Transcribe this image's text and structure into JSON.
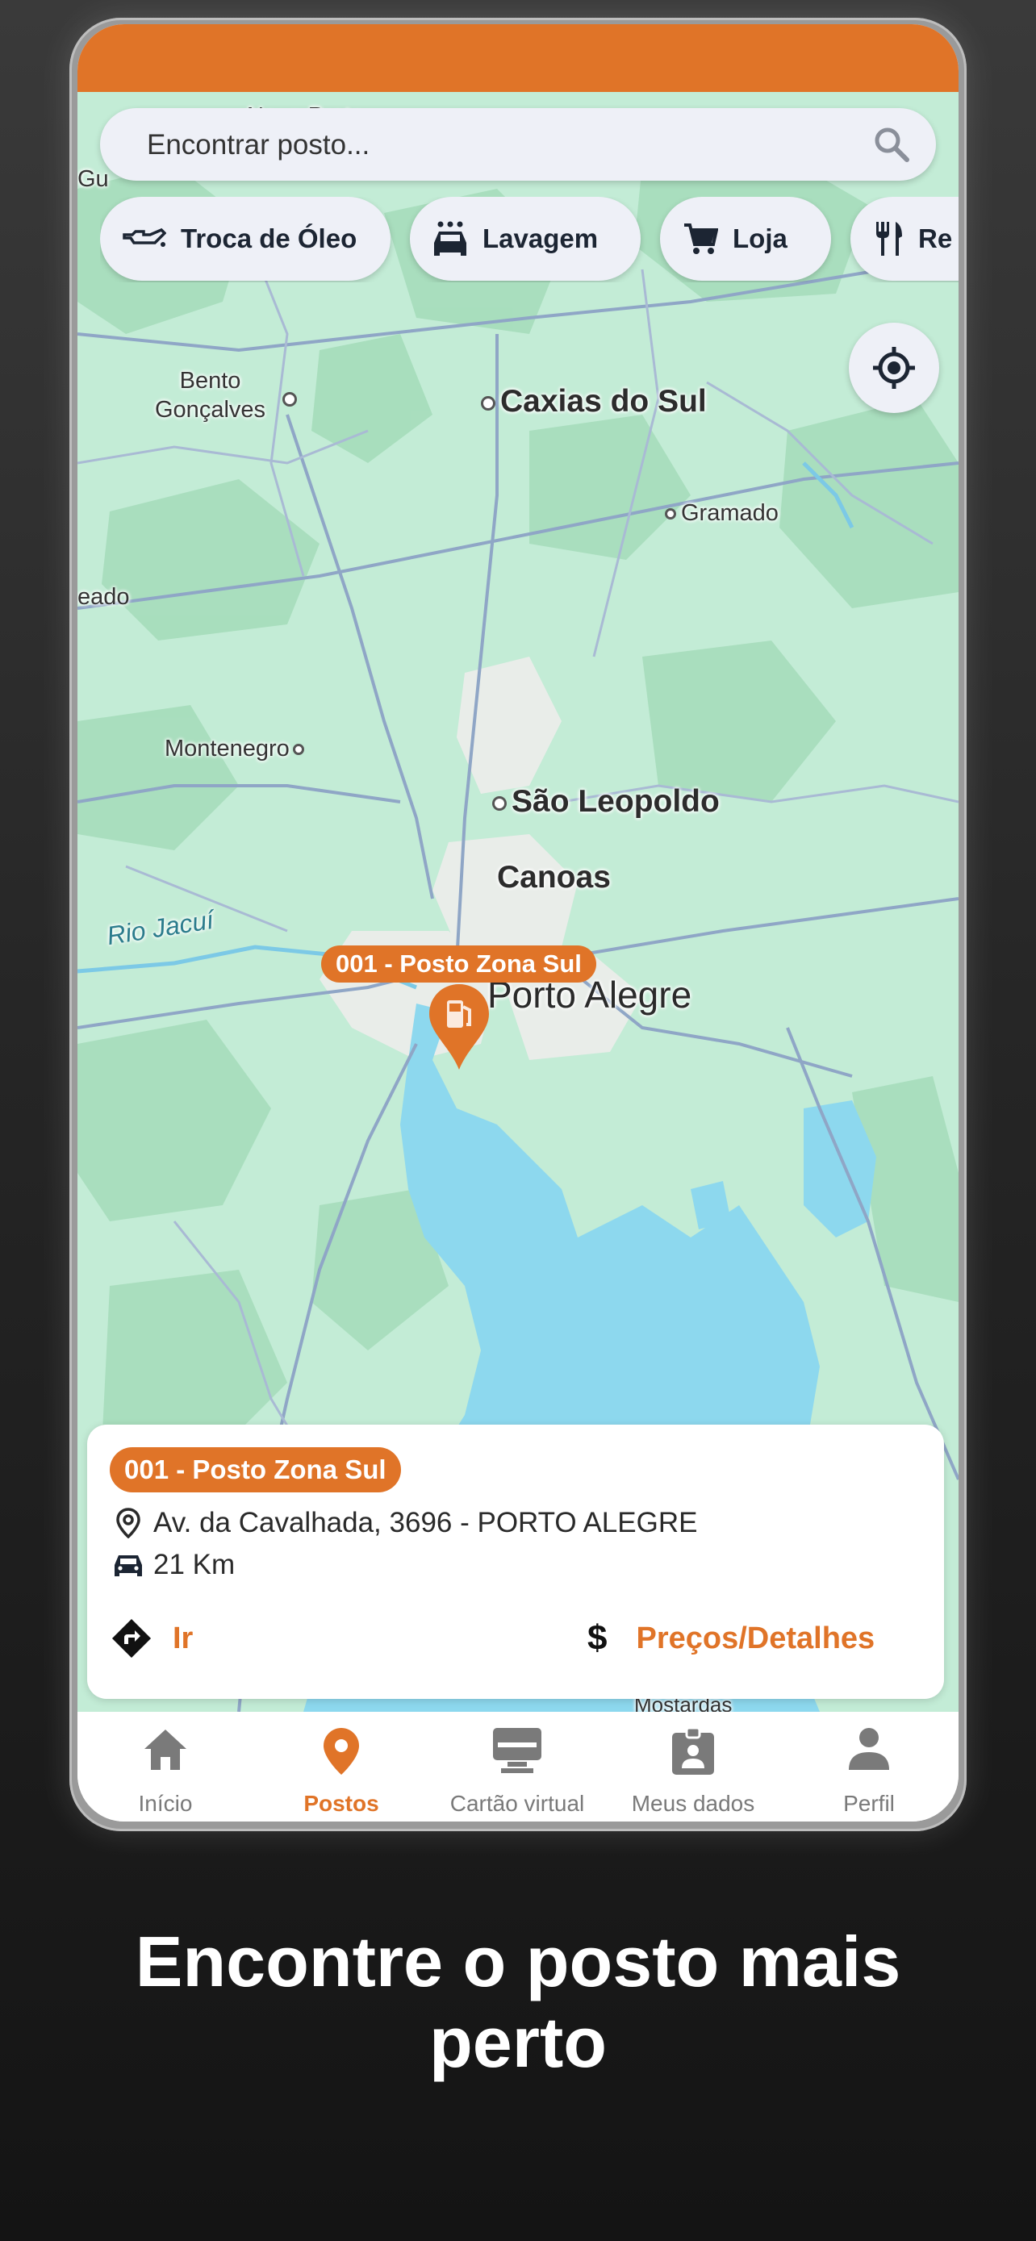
{
  "search": {
    "placeholder": "Encontrar posto..."
  },
  "chips": [
    {
      "label": "Troca de Óleo",
      "icon": "oil-change-icon"
    },
    {
      "label": "Lavagem",
      "icon": "car-wash-icon"
    },
    {
      "label": "Loja",
      "icon": "shopping-cart-icon"
    },
    {
      "label": "Re",
      "icon": "restaurant-icon"
    }
  ],
  "map": {
    "labels": {
      "top_partial": "Nova Prata",
      "left_partial": "Gu",
      "bento": "Bento\nGonçalves",
      "caxias": "Caxias do Sul",
      "gramado": "Gramado",
      "left_edge": "eado",
      "montenegro": "Montenegro",
      "sao_leopoldo": "São Leopoldo",
      "canoas": "Canoas",
      "rio_jacui": "Rio Jacuí",
      "porto_alegre": "Porto Alegre",
      "mostardas": "Mostardas"
    },
    "marker": {
      "label": "001 - Posto Zona Sul",
      "icon": "fuel-pump-icon"
    }
  },
  "card": {
    "badge": "001 - Posto Zona Sul",
    "address": "Av. da Cavalhada, 3696 - PORTO ALEGRE",
    "distance": "21 Km",
    "go_label": "Ir",
    "details_label": "Preços/Detalhes"
  },
  "nav": [
    {
      "label": "Início",
      "icon": "home-icon",
      "active": false
    },
    {
      "label": "Postos",
      "icon": "location-pin-icon",
      "active": true
    },
    {
      "label": "Cartão virtual",
      "icon": "virtual-card-icon",
      "active": false
    },
    {
      "label": "Meus dados",
      "icon": "badge-icon",
      "active": false
    },
    {
      "label": "Perfil",
      "icon": "person-icon",
      "active": false
    }
  ],
  "headline": "Encontre o posto mais perto",
  "colors": {
    "accent": "#e07428",
    "map_land": "#bfe9d2",
    "water": "#8dd8ee",
    "text_dark": "#1c2533"
  }
}
